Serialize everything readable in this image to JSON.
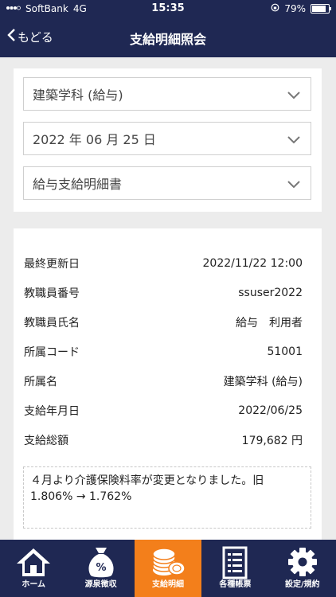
{
  "statusbar": {
    "carrier": "SoftBank",
    "network": "4G",
    "time": "15:35",
    "battery": "79%",
    "battery_level": 0.79
  },
  "navbar": {
    "back_label": "もどる",
    "title": "支給明細照会"
  },
  "filters": {
    "department": "建築学科 (給与)",
    "date": "2022 年 06 月 25 日",
    "document": "給与支給明細書"
  },
  "details": [
    {
      "label": "最終更新日",
      "value": "2022/11/22 12:00"
    },
    {
      "label": "教職員番号",
      "value": "ssuser2022"
    },
    {
      "label": "教職員氏名",
      "value": "給与　利用者"
    },
    {
      "label": "所属コード",
      "value": "51001"
    },
    {
      "label": "所属名",
      "value": "建築学科 (給与)"
    },
    {
      "label": "支給年月日",
      "value": "2022/06/25"
    },
    {
      "label": "支給総額",
      "value": "179,682 円"
    }
  ],
  "notice": "４月より介護保険料率が変更となりました。旧 1.806% → 1.762%",
  "tabs": [
    {
      "label": "ホーム",
      "icon": "home-icon"
    },
    {
      "label": "源泉徴収",
      "icon": "money-bag-icon"
    },
    {
      "label": "支給明細",
      "icon": "coins-icon",
      "active": true
    },
    {
      "label": "各種帳票",
      "icon": "document-list-icon"
    },
    {
      "label": "設定/規約",
      "icon": "gear-icon"
    }
  ],
  "colors": {
    "header": "#1f2853",
    "active_tab": "#f37f1b"
  }
}
